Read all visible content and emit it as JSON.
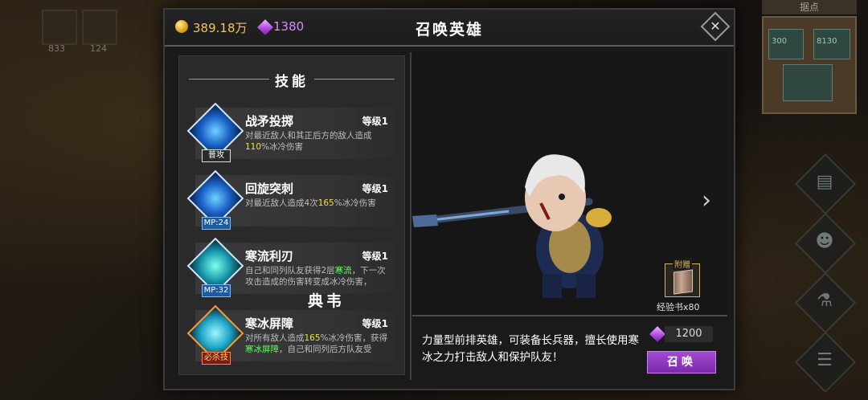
{
  "background": {
    "slot_counts": [
      "833",
      "124"
    ],
    "minimap_label": "据点",
    "minimap_numbers": [
      "300",
      "8130"
    ]
  },
  "header": {
    "gold": "389.18万",
    "gems": "1380",
    "title": "召唤英雄",
    "close_label": "✕"
  },
  "skills": {
    "title": "技能",
    "items": [
      {
        "name": "战矛投掷",
        "level": "等级1",
        "tag": "普攻",
        "desc_parts": [
          "对最近敌人和其正后方的敌人造成",
          "110",
          "%冰冷伤害"
        ]
      },
      {
        "name": "回旋突刺",
        "level": "等级1",
        "tag": "MP:24",
        "desc_parts": [
          "对最近敌人造成4次",
          "165",
          "%冰冷伤害"
        ]
      },
      {
        "name": "寒流利刃",
        "level": "等级1",
        "tag": "MP:32",
        "desc_parts": [
          "自己和同列队友获得2层",
          "寒流",
          "，下一次攻击造成的伤害转变成冰冷伤害，"
        ]
      },
      {
        "name": "寒冰屏障",
        "level": "等级1",
        "tag": "必杀技",
        "desc_parts": [
          "对所有敌人造成",
          "165",
          "%冰冷伤害，获得",
          "寒冰屏障",
          "，自己和同列后方队友受"
        ]
      }
    ]
  },
  "hero": {
    "name": "典韦",
    "description": "力量型前排英雄，可装备长兵器，擅长使用寒冰之力打击敌人和保护队友！",
    "bonus_tag": "附赠",
    "bonus_item": "经验书x80",
    "cost": "1200",
    "summon_label": "召唤",
    "next_arrow": "›"
  },
  "colors": {
    "gold": "#f0c45a",
    "gem": "#d88df6",
    "highlight_yellow": "#f2e23a",
    "highlight_green": "#5dff62",
    "summon_button": "#8e36bd"
  },
  "icons": [
    "gold-coin-icon",
    "gem-icon",
    "close-icon",
    "spear-skill-icon",
    "whirl-skill-icon",
    "blade-skill-icon",
    "ice-shield-skill-icon",
    "next-arrow-icon",
    "exp-book-icon"
  ]
}
